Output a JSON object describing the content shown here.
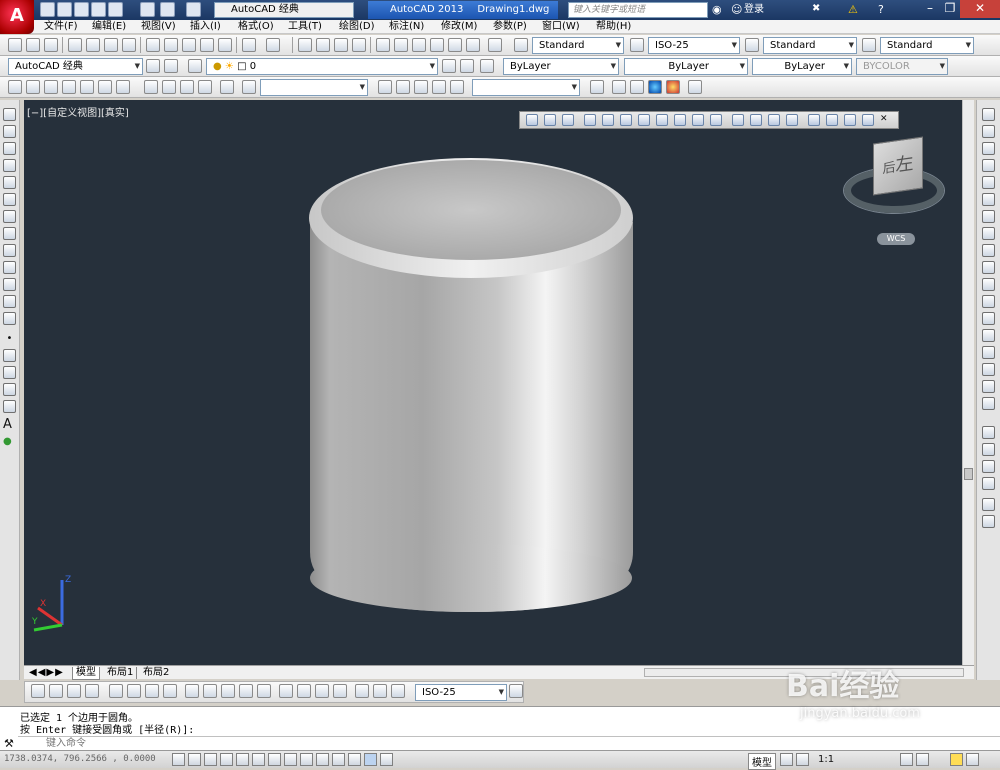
{
  "titlebar": {
    "app_icon": "A",
    "workspace": "AutoCAD 经典",
    "app_name": "AutoCAD 2013",
    "doc_name": "Drawing1.dwg",
    "search_placeholder": "键入关键字或短语",
    "login": "登录",
    "controls": [
      "minimize-icon",
      "restore-icon",
      "close-icon"
    ]
  },
  "menubar": {
    "items": [
      "文件(F)",
      "编辑(E)",
      "视图(V)",
      "插入(I)",
      "格式(O)",
      "工具(T)",
      "绘图(D)",
      "标注(N)",
      "修改(M)",
      "参数(P)",
      "窗口(W)",
      "帮助(H)"
    ]
  },
  "toolbar_standard": {
    "text_style": "Standard",
    "dim_style": "ISO-25",
    "table_style": "Standard",
    "multileader_style": "Standard"
  },
  "toolbar_layers": {
    "workspace": "AutoCAD 经典",
    "layer": "0",
    "color": "ByLayer",
    "linetype": "ByLayer",
    "lineweight": "ByLayer",
    "plotstyle": "BYCOLOR"
  },
  "viewport": {
    "label": "[−][自定义视图][真实]",
    "viewcube_face": "左",
    "viewcube_face2": "后",
    "wcs": "WCS",
    "background": "#26303b"
  },
  "layout_tabs": [
    "模型",
    "布局1",
    "布局2"
  ],
  "dim_toolbar": {
    "dim_style": "ISO-25"
  },
  "command": {
    "history": [
      "已选定 1 个边用于圆角。",
      "按 Enter 键接受圆角或 [半径(R)]:"
    ],
    "input_placeholder": "键入命令"
  },
  "statusbar": {
    "coords": "1738.0374, 796.2566 , 0.0000",
    "model_label": "模型",
    "scale": "1:1"
  },
  "watermark": {
    "brand": "Bai经验",
    "url": "jingyan.baidu.com"
  }
}
